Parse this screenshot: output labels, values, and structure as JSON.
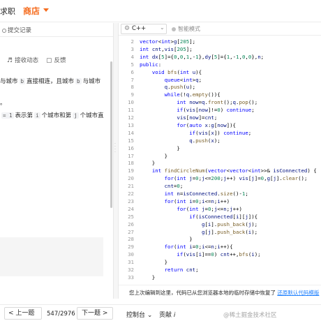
{
  "header": {
    "nav_job": "求职",
    "nav_store": "商店"
  },
  "left": {
    "submit_record": "提交记录",
    "follow_label": "接收动态",
    "feedback_label": "反馈",
    "desc1_pre": "与城市",
    "desc1_chip": "b",
    "desc1_mid": "直接相连，且城市",
    "desc1_chip2": "b",
    "desc1_post": "与城市",
    "desc2_text": "。",
    "desc3_chip": "= 1",
    "desc3_pre": "表示第",
    "desc3_chip2": "i",
    "desc3_mid": "个城市和第",
    "desc3_chip3": "j",
    "desc3_post": "个城市直"
  },
  "editor": {
    "language": "C++",
    "smart_mode": "智能模式",
    "lines": [
      {
        "n": "2",
        "t": "vector<int>g[205];"
      },
      {
        "n": "3",
        "t": "int cnt,vis[205];"
      },
      {
        "n": "4",
        "t": "int dx[5]={0,0,1,-1},dy[5]={1,-1,0,0},n;"
      },
      {
        "n": "5",
        "t": "public:"
      },
      {
        "n": "6",
        "t": "    void bfs(int u){"
      },
      {
        "n": "7",
        "t": "        queue<int>q;"
      },
      {
        "n": "8",
        "t": "        q.push(u);"
      },
      {
        "n": "9",
        "t": "        while(!q.empty()){"
      },
      {
        "n": "10",
        "t": "            int now=q.front();q.pop();"
      },
      {
        "n": "11",
        "t": "            if(vis[now]!=0) continue;"
      },
      {
        "n": "12",
        "t": "            vis[now]=cnt;"
      },
      {
        "n": "13",
        "t": "            for(auto x:g[now]){"
      },
      {
        "n": "14",
        "t": "                if(vis[x]) continue;"
      },
      {
        "n": "15",
        "t": "                q.push(x);"
      },
      {
        "n": "16",
        "t": "            }"
      },
      {
        "n": "17",
        "t": "        }"
      },
      {
        "n": "18",
        "t": "    }"
      },
      {
        "n": "19",
        "t": "    int findCircleNum(vector<vector<int>>& isConnected) {"
      },
      {
        "n": "20",
        "t": "        for(int j=0;j<=200;j++) vis[j]=0,g[j].clear();"
      },
      {
        "n": "21",
        "t": "        cnt=0;"
      },
      {
        "n": "22",
        "t": "        int n=isConnected.size()-1;"
      },
      {
        "n": "23",
        "t": "        for(int i=0;i<=n;i++)"
      },
      {
        "n": "24",
        "t": "            for(int j=0;j<=n;j++)"
      },
      {
        "n": "25",
        "t": "                if(isConnected[i][j]){"
      },
      {
        "n": "26",
        "t": "                    g[i].push_back(j);"
      },
      {
        "n": "27",
        "t": "                    g[j].push_back(i);"
      },
      {
        "n": "28",
        "t": "                }"
      },
      {
        "n": "29",
        "t": "        for(int i=0;i<=n;i++){"
      },
      {
        "n": "30",
        "t": "            if(vis[i]==0) cnt++,bfs(i);"
      },
      {
        "n": "31",
        "t": "        }"
      },
      {
        "n": "32",
        "t": "        return cnt;"
      },
      {
        "n": "33",
        "t": "    }"
      }
    ]
  },
  "draft": {
    "text": "您上次编辑到这里，代码已从您浏览器本地的临时存储中恢复了",
    "link": "还原默认代码模版"
  },
  "footer": {
    "prev_label": "上一题",
    "page_count": "547/2976",
    "next_label": "下一题",
    "console_label": "控制台",
    "contrib_label": "贡献",
    "watermark": "@稀土掘金技术社区"
  }
}
